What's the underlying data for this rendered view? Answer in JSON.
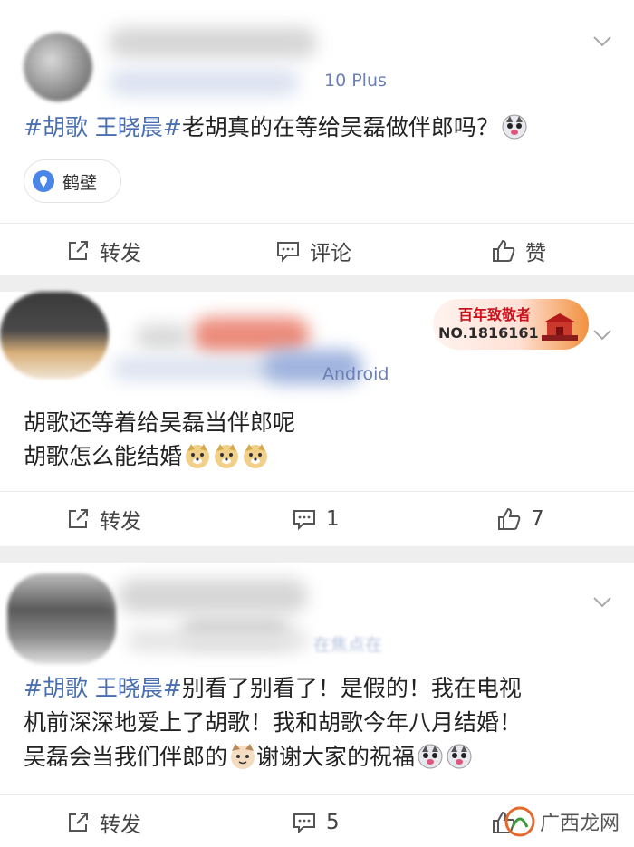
{
  "posts": [
    {
      "meta": "10 Plus",
      "content": {
        "hashtag": "#胡歌 王晓晨#",
        "text": "老胡真的在等给吴磊做伴郎吗？"
      },
      "location": "鹤壁",
      "actions": {
        "repost": "转发",
        "comment": "评论",
        "like": "赞"
      }
    },
    {
      "meta": "Android",
      "badge": {
        "title": "百年致敬者",
        "number": "NO.1816161"
      },
      "content": {
        "line1": "胡歌还等着给吴磊当伴郎呢",
        "line2": "胡歌怎么能结婚"
      },
      "actions": {
        "repost": "转发",
        "comment": "1",
        "like": "7"
      }
    },
    {
      "meta": "在焦点在",
      "content": {
        "hashtag": "#胡歌 王晓晨#",
        "line1": "别看了别看了！是假的！我在电视",
        "line2": "机前深深地爱上了胡歌！我和胡歌今年八月结婚！",
        "line3a": "吴磊会当我们伴郎的",
        "line3b": "谢谢大家的祝福"
      },
      "actions": {
        "repost": "转发",
        "comment": "5"
      }
    }
  ],
  "watermark": "广西龙网",
  "colors": {
    "link": "#4a6fb0",
    "separator": "#eeeeee",
    "badge_red": "#c8121c"
  }
}
